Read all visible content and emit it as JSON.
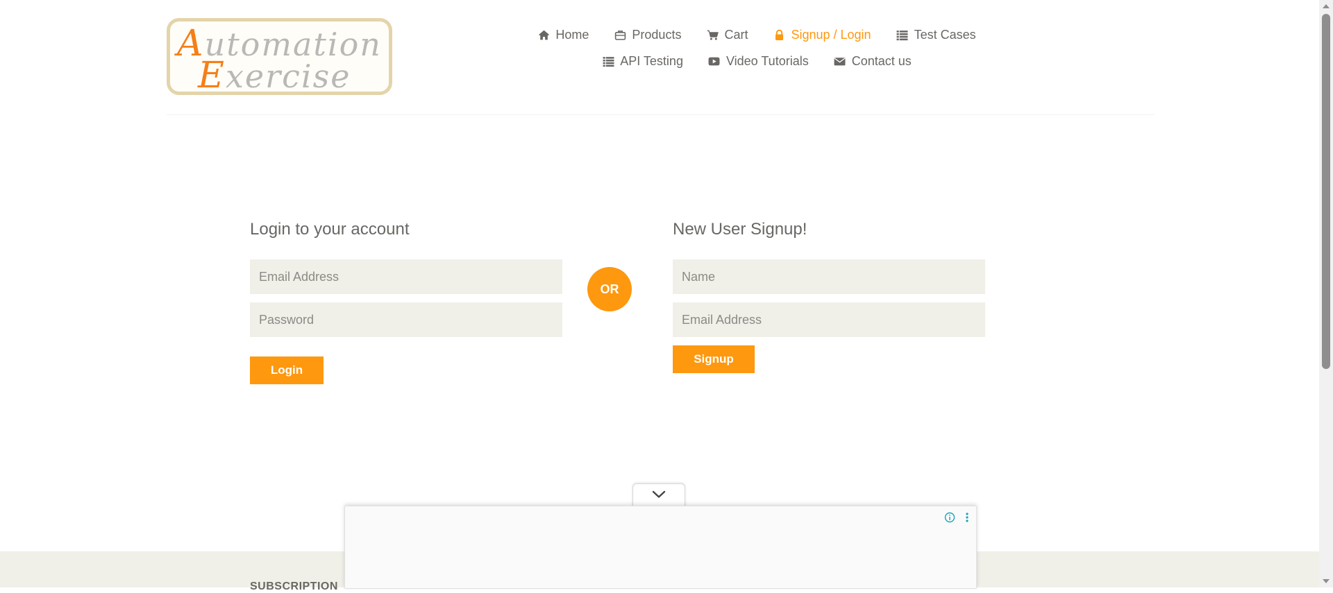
{
  "logo": {
    "line1_cap": "A",
    "line1_rest": "utomation",
    "line2_cap": "E",
    "line2_rest": "xercise"
  },
  "nav": {
    "items": [
      {
        "label": "Home",
        "icon": "home-icon"
      },
      {
        "label": "Products",
        "icon": "briefcase-icon"
      },
      {
        "label": "Cart",
        "icon": "cart-icon"
      },
      {
        "label": "Signup / Login",
        "icon": "lock-icon",
        "active": true
      },
      {
        "label": "Test Cases",
        "icon": "list-icon"
      },
      {
        "label": "API Testing",
        "icon": "list-icon"
      },
      {
        "label": "Video Tutorials",
        "icon": "youtube-play-icon"
      },
      {
        "label": "Contact us",
        "icon": "envelope-icon"
      }
    ]
  },
  "login": {
    "title": "Login to your account",
    "email_placeholder": "Email Address",
    "password_placeholder": "Password",
    "button": "Login"
  },
  "divider_label": "OR",
  "signup": {
    "title": "New User Signup!",
    "name_placeholder": "Name",
    "email_placeholder": "Email Address",
    "button": "Signup"
  },
  "footer": {
    "subscription_title": "SUBSCRIPTION"
  },
  "colors": {
    "accent": "#fe980f",
    "text": "#696763",
    "field_bg": "#f0f0e9",
    "ad_icon": "#1aa3b8"
  }
}
